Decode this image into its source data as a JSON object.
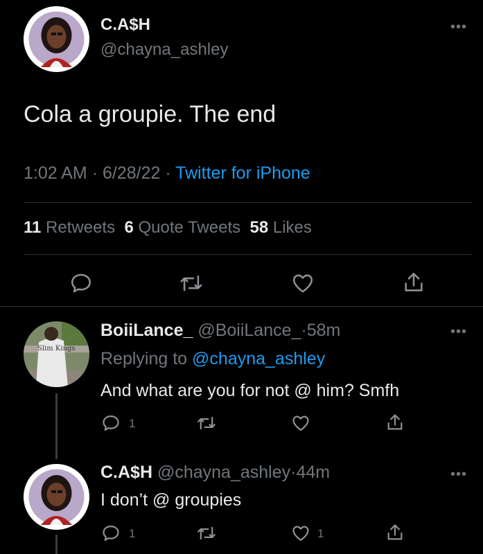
{
  "main_tweet": {
    "display_name": "C.A$H",
    "handle": "@chayna_ashley",
    "text": "Cola a groupie. The end",
    "time": "1:02 AM",
    "date": "6/28/22",
    "source": "Twitter for iPhone",
    "stats": {
      "retweets_count": "11",
      "retweets_label": "Retweets",
      "quotes_count": "6",
      "quotes_label": "Quote Tweets",
      "likes_count": "58",
      "likes_label": "Likes"
    }
  },
  "replies": [
    {
      "display_name": "BoiiLance_",
      "handle": "@BoiiLance_",
      "age": "58m",
      "replying_prefix": "Replying to",
      "replying_to": "@chayna_ashley",
      "text": "And what are you for not @ him? Smfh",
      "reply_count": "1",
      "retweet_count": "",
      "like_count": ""
    },
    {
      "display_name": "C.A$H",
      "handle": "@chayna_ashley",
      "age": "44m",
      "text": "I don’t @ groupies",
      "reply_count": "1",
      "retweet_count": "",
      "like_count": "1"
    }
  ],
  "separator": "·",
  "more_glyph": "•••",
  "icons": [
    "reply-icon",
    "retweet-icon",
    "like-icon",
    "share-icon",
    "more-icon"
  ],
  "colors": {
    "background": "#000000",
    "text": "#e7e9ea",
    "muted": "#71767b",
    "link": "#1d9bf0",
    "divider": "#2f3336"
  }
}
